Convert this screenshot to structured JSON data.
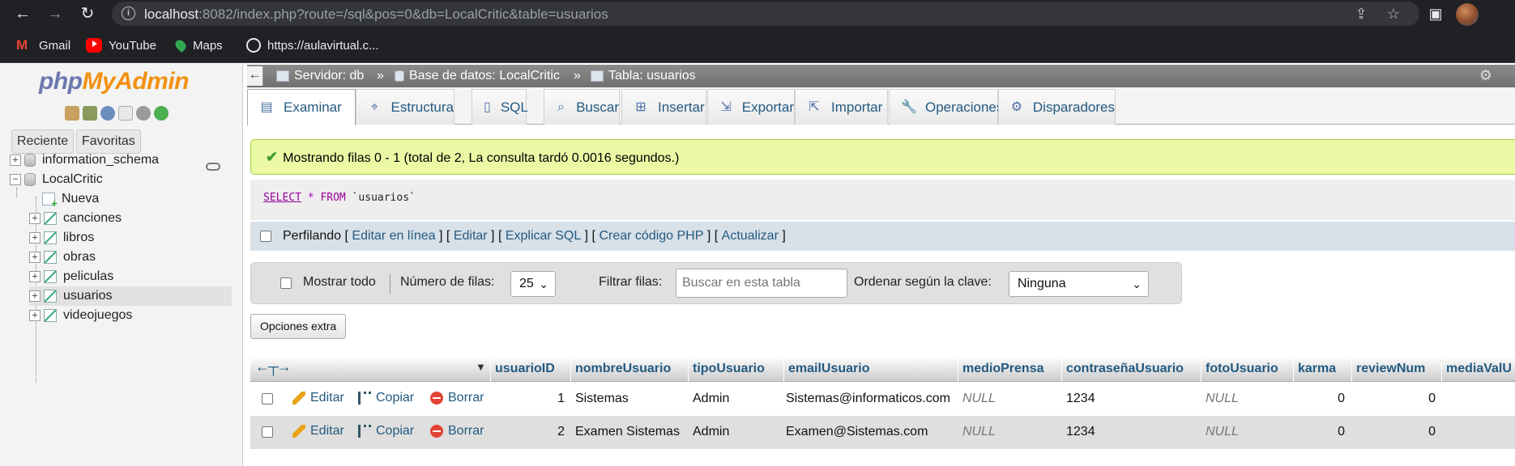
{
  "browser": {
    "url_host": "localhost",
    "url_rest": ":8082/index.php?route=/sql&pos=0&db=LocalCritic&table=usuarios",
    "bookmarks": [
      "Gmail",
      "YouTube",
      "Maps",
      "https://aulavirtual.c..."
    ]
  },
  "sidebar": {
    "logo_php": "php",
    "logo_myadmin": "MyAdmin",
    "recent_label": "Reciente",
    "favorites_label": "Favoritas",
    "tree": {
      "db1": "information_schema",
      "db2": "LocalCritic",
      "new": "Nueva",
      "tables": [
        "canciones",
        "libros",
        "obras",
        "peliculas",
        "usuarios",
        "videojuegos"
      ]
    }
  },
  "breadcrumb": {
    "server": "Servidor: db",
    "database": "Base de datos: LocalCritic",
    "table": "Tabla: usuarios",
    "sep": "»"
  },
  "tabs": [
    "Examinar",
    "Estructura",
    "SQL",
    "Buscar",
    "Insertar",
    "Exportar",
    "Importar",
    "Operaciones",
    "Disparadores"
  ],
  "message": "Mostrando filas 0 - 1 (total de 2, La consulta tardó 0.0016 segundos.)",
  "sql": {
    "select": "SELECT",
    "star": "*",
    "from": "FROM",
    "table": "`usuarios`"
  },
  "profiling": {
    "label": "Perfilando",
    "links": [
      "Editar en línea",
      "Editar",
      "Explicar SQL",
      "Crear código PHP",
      "Actualizar"
    ]
  },
  "controls": {
    "show_all": "Mostrar todo",
    "rows_label": "Número de filas:",
    "rows_value": "25",
    "filter_label": "Filtrar filas:",
    "filter_placeholder": "Buscar en esta tabla",
    "sort_label": "Ordenar según la clave:",
    "sort_value": "Ninguna",
    "extra_options": "Opciones extra"
  },
  "table": {
    "columns": [
      "usuarioID",
      "nombreUsuario",
      "tipoUsuario",
      "emailUsuario",
      "medioPrensa",
      "contraseñaUsuario",
      "fotoUsuario",
      "karma",
      "reviewNum",
      "mediaValU"
    ],
    "actions": {
      "edit": "Editar",
      "copy": "Copiar",
      "delete": "Borrar"
    },
    "rows": [
      {
        "usuarioID": "1",
        "nombreUsuario": "Sistemas",
        "tipoUsuario": "Admin",
        "emailUsuario": "Sistemas@informaticos.com",
        "medioPrensa": "NULL",
        "contrasena": "1234",
        "fotoUsuario": "NULL",
        "karma": "0",
        "reviewNum": "0"
      },
      {
        "usuarioID": "2",
        "nombreUsuario": "Examen Sistemas",
        "tipoUsuario": "Admin",
        "emailUsuario": "Examen@Sistemas.com",
        "medioPrensa": "NULL",
        "contrasena": "1234",
        "fotoUsuario": "NULL",
        "karma": "0",
        "reviewNum": "0"
      }
    ]
  }
}
